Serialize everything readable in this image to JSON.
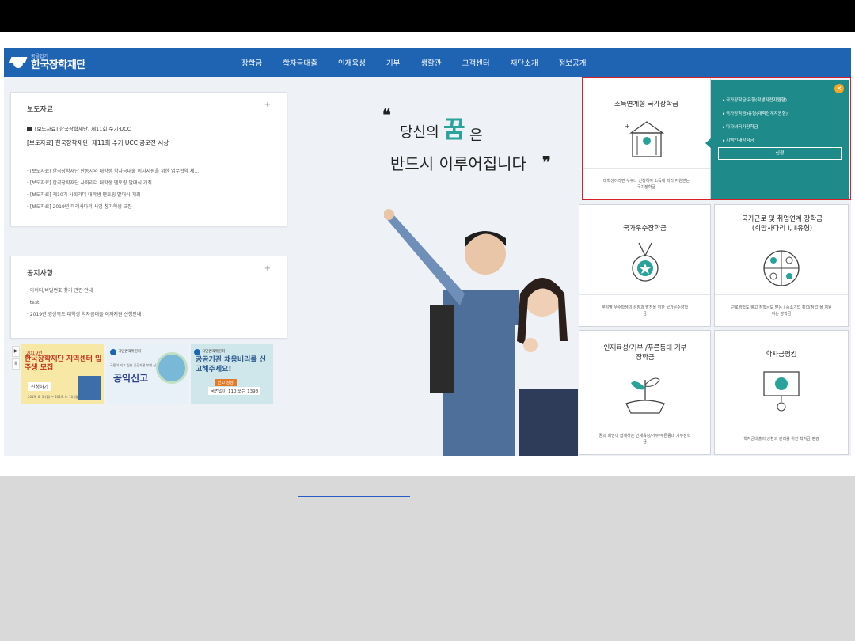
{
  "header": {
    "logo_sub": "꿈을잡기",
    "logo_name": "한국장학재단",
    "nav": [
      "장학금",
      "학자금대출",
      "인재육성",
      "기부",
      "생활관",
      "고객센터",
      "재단소개",
      "정보공개"
    ]
  },
  "press": {
    "title": "보도자료",
    "plus": "+",
    "featured_1": "[보도자료] 한국장학재단, 제11회 수기·UCC",
    "featured_2": "[보도자료] 한국장학재단, 제11회 수기·UCC 공모전 시상",
    "items": [
      "[보도자료] 한국장학재단 한동시와 대학생 학자금대출 이자지원을 위한 업무협약 체...",
      "[보도자료] 한국장학재단 사회리더 대학생 멘토링 발대식 개최",
      "[보도자료] 제10기 사회리더 대학생 멘토링 발대식 개최",
      "[보도자료] 2019년 미래사다리 사업 참가학생 모집"
    ]
  },
  "notice": {
    "title": "공지사항",
    "plus": "+",
    "items": [
      "아이디/비밀번호 찾기 관련 안내",
      "test",
      "2019년 경상북도 대학생 학자금대출 이자지원 신청안내"
    ]
  },
  "banners": {
    "ctrl_play": "▶",
    "ctrl_pause": "II",
    "b1_year": "2019년",
    "b1_title": "한국장학재단 지역센터 입주생 모집",
    "b1_btn": "신청하기",
    "b1_date": "2019. 6. 3.(월) ~ 2019. 6. 10.(월) 18:00까지",
    "b2_org": "국민권익위원회",
    "b2_small": "국민이 가고 싶은 공공기관 부패 신고",
    "b2_title": "공익신고",
    "b3_org": "국민권익위원회",
    "b3_title": "공공기관 채용비리를 신고해주세요!",
    "b3_btn": "신고 상담",
    "b3_tel": "국번없이 110 또는 1398"
  },
  "slogan": {
    "open_quote": "❝",
    "part1": "당신의",
    "big": "꿈",
    "part1_end": "은",
    "part2": "반드시 이루어집니다",
    "close_quote": "❞"
  },
  "cards": {
    "income": {
      "title": "소득연계형 국가장학금",
      "desc": "대학생이라면 누구나 신청하여 소득에 따라 지원받는 국가장학금"
    },
    "excellence": {
      "title": "국가우수장학금",
      "desc": "분야별 우수학생의 성장과 발전을 위한 국가우수장학금"
    },
    "work": {
      "title": "국가근로 및 취업연계 장학금 (희망사다리 Ⅰ, Ⅱ유형)",
      "desc": "근로경험도 쌓고 장학금도 받는 / 중소기업 취업(창업)을 지원하는 장학금"
    },
    "talent": {
      "title": "인재육성/기부 /푸른등대 기부장학금",
      "desc": "꿈과 희망이 함께하는 인재육성/기부/푸른등대 기부장학금"
    },
    "banking": {
      "title": "학자금뱅킹",
      "desc": "학자금대출의 상환과 관리를 위한 학자금 뱅킹"
    }
  },
  "popup": {
    "close": "×",
    "items": [
      "국가장학금Ⅰ유형(학생직접지원형)",
      "국가장학금Ⅱ유형(대학연계지원형)",
      "다자녀국가장학금",
      "지역인재장학금"
    ],
    "apply": "신청"
  }
}
